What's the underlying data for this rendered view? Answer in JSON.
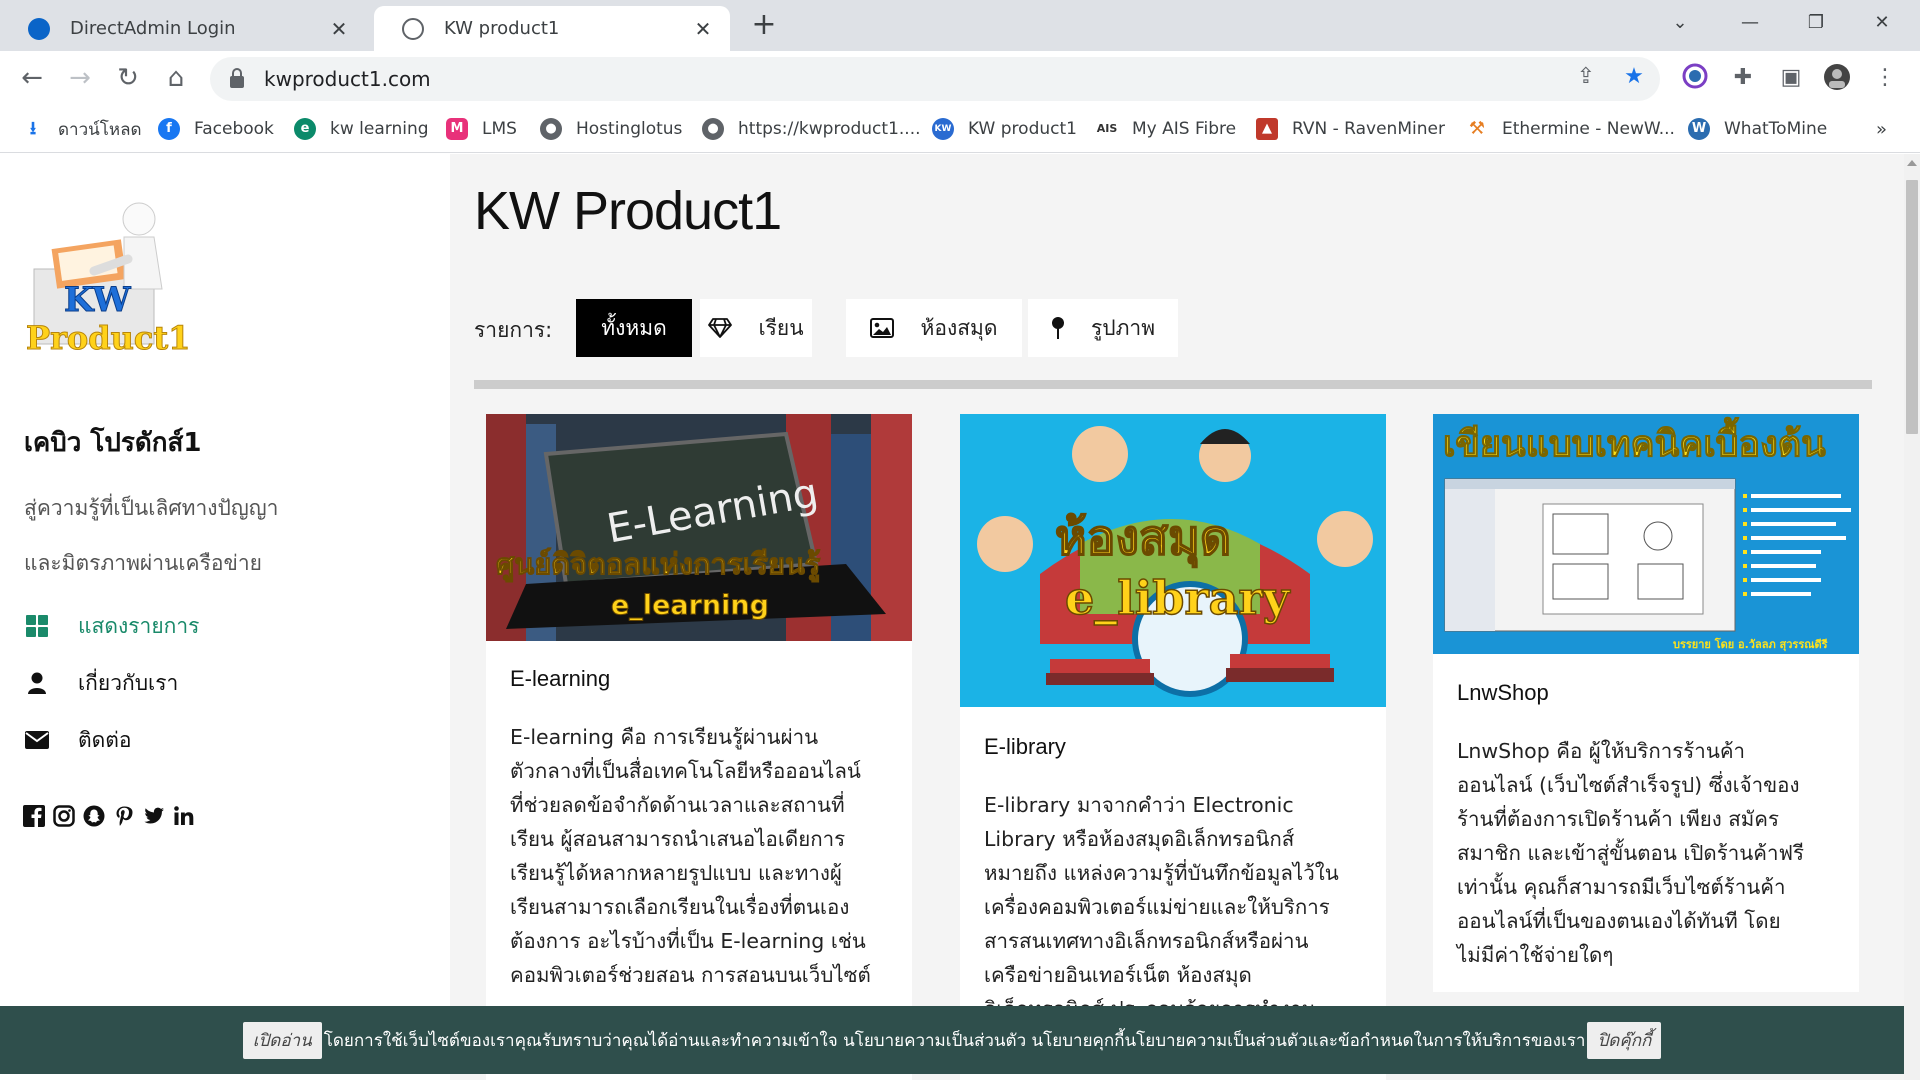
{
  "tabs": [
    {
      "title": "DirectAdmin Login",
      "favicon_color": "#0a64c8"
    },
    {
      "title": "KW product1",
      "favicon_color": "#5f6368"
    }
  ],
  "address_bar": {
    "url": "kwproduct1.com"
  },
  "bookmarks": [
    {
      "label": "ดาวน์โหลด",
      "icon": "download-icon",
      "color": "#1a73e8"
    },
    {
      "label": "Facebook",
      "icon": "facebook-icon",
      "color": "#1877f2"
    },
    {
      "label": "kw learning",
      "icon": "kw-learning-icon",
      "color": "#0b8a6a"
    },
    {
      "label": "LMS",
      "icon": "lms-icon",
      "color": "#e8317a"
    },
    {
      "label": "Hostinglotus",
      "icon": "globe-icon",
      "color": "#5f6368"
    },
    {
      "label": "https://kwproduct1....",
      "icon": "globe-icon",
      "color": "#5f6368"
    },
    {
      "label": "KW product1",
      "icon": "kw-product-icon",
      "color": "#2a6bd1"
    },
    {
      "label": "My AIS Fibre",
      "icon": "ais-icon",
      "color": "#7ab800"
    },
    {
      "label": "RVN - RavenMiner",
      "icon": "ravenminer-icon",
      "color": "#c0392b"
    },
    {
      "label": "Ethermine - NewW...",
      "icon": "ethermine-icon",
      "color": "#e67e22"
    },
    {
      "label": "WhatToMine",
      "icon": "whattomine-icon",
      "color": "#2b6cb0"
    }
  ],
  "sidebar": {
    "logo_text": {
      "line1": "KW",
      "line2": "Product1"
    },
    "site_name": "เคบิว โปรดักส์1",
    "tagline1": "สู่ความรู้ที่เป็นเลิศทางปัญญา",
    "tagline2": "และมิตรภาพผ่านเครือข่าย",
    "nav": [
      {
        "label": "แสดงรายการ",
        "icon": "grid-icon"
      },
      {
        "label": "เกี่ยวกับเรา",
        "icon": "user-icon"
      },
      {
        "label": "ติดต่อ",
        "icon": "envelope-icon"
      }
    ]
  },
  "main": {
    "title": "KW Product1",
    "filter_label": "รายการ:",
    "filters": [
      {
        "label": "ทั้งหมด",
        "icon": "",
        "active": true
      },
      {
        "label": "เรียน",
        "icon": "diamond-icon",
        "active": false
      },
      {
        "label": "ห้องสมุด",
        "icon": "image-icon",
        "active": false
      },
      {
        "label": "รูปภาพ",
        "icon": "pin-icon",
        "active": false
      }
    ],
    "cards": [
      {
        "title": "E-learning",
        "image_text": {
          "line1": "E-Learning",
          "line2": "ศูนย์ดิจิตอลแห่งการเรียนรู้",
          "line3": "e_learning"
        },
        "lines": [
          "E-learning คือ การเรียนรู้ผ่านผ่าน",
          "ตัวกลางที่เป็นสื่อเทคโนโลยีหรือออนไลน์",
          "ที่ช่วยลดข้อจำกัดด้านเวลาและสถานที่",
          "เรียน ผู้สอนสามารถนำเสนอไอเดียการ",
          "เรียนรู้ได้หลากหลายรูปแบบ และทางผู้",
          "เรียนสามารถเลือกเรียนในเรื่องที่ตนเอง",
          "ต้องการ อะไรบ้างที่เป็น E-learning เช่น",
          "คอมพิวเตอร์ช่วยสอน การสอนบนเว็บไซต์"
        ]
      },
      {
        "title": "E-library",
        "image_text": {
          "line1": "ห้องสมุด",
          "line2": "e_library"
        },
        "lines": [
          "E-library มาจากคำว่า Electronic",
          "Library หรือห้องสมุดอิเล็กทรอนิกส์",
          "หมายถึง แหล่งความรู้ที่บันทึกข้อมูลไว้ใน",
          "เครื่องคอมพิวเตอร์แม่ข่ายและให้บริการ",
          "สารสนเทศทางอิเล็กทรอนิกส์หรือผ่าน",
          "เครือข่ายอินเทอร์เน็ต ห้องสมุด",
          "อิเล็กทรอนิกส์ ประกอบด้วยการทำงาน"
        ]
      },
      {
        "title": "LnwShop",
        "image_text": {
          "line1": "เขียนแบบเทคนิคเบื้องต้น",
          "credit": "บรรยาย โดย อ.วัลลภ สุวรรณดีรี"
        },
        "lines": [
          "LnwShop คือ ผู้ให้บริการร้านค้า",
          "ออนไลน์ (เว็บไซต์สำเร็จรูป) ซึ่งเจ้าของ",
          "ร้านที่ต้องการเปิดร้านค้า เพียง สมัคร",
          "สมาชิก และเข้าสู่ขั้นตอน เปิดร้านค้าฟรี",
          "เท่านั้น คุณก็สามารถมีเว็บไซต์ร้านค้า",
          "ออนไลน์ที่เป็นของตนเองได้ทันที โดย",
          "ไม่มีค่าใช้จ่ายใดๆ"
        ]
      }
    ]
  },
  "cookie_bar": {
    "read_label": "เปิดอ่าน",
    "text": "โดยการใช้เว็บไซต์ของเราคุณรับทราบว่าคุณได้อ่านและทำความเข้าใจ นโยบายความเป็นส่วนตัว นโยบายคุกกี้นโยบายความเป็นส่วนตัวและข้อกำหนดในการให้บริการของเรา",
    "close_label": "ปิดคุ๊กกี้"
  },
  "colors": {
    "accent": "#1a8a6a",
    "cookie_bg": "#2f4f4c",
    "active_filter": "#000000"
  }
}
